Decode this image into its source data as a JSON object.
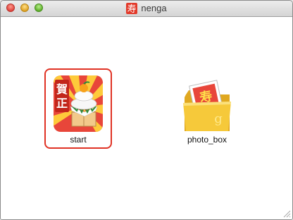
{
  "window": {
    "title": "nenga",
    "title_icon_char": "寿"
  },
  "items": [
    {
      "label": "start",
      "selected": true,
      "badge_chars": [
        "賀",
        "正"
      ]
    },
    {
      "label": "photo_box",
      "selected": false,
      "photo_char": "寿",
      "folder_char": "g"
    }
  ],
  "colors": {
    "selection": "#e03224",
    "icon_red": "#e23a2a",
    "folder_yellow": "#f6c93a"
  }
}
